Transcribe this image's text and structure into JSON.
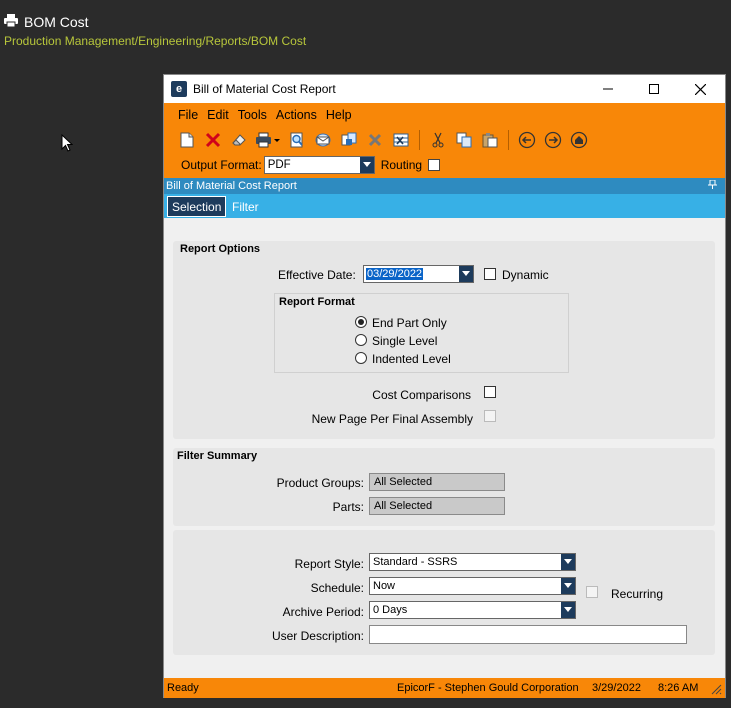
{
  "app": {
    "title": "BOM Cost",
    "breadcrumb": "Production Management/Engineering/Reports/BOM Cost"
  },
  "window": {
    "title": "Bill of Material Cost Report",
    "menu": [
      "File",
      "Edit",
      "Tools",
      "Actions",
      "Help"
    ],
    "toolbar_icons": [
      "new-icon",
      "delete-icon",
      "clear-icon",
      "print-icon",
      "print-preview-icon",
      "email-icon",
      "generate-icon",
      "cancel-icon",
      "excel-icon",
      "cut-icon",
      "copy-icon",
      "paste-icon",
      "back-icon",
      "forward-icon",
      "home-icon"
    ],
    "output_format_label": "Output Format:",
    "output_format_value": "PDF",
    "routing_label": "Routing",
    "panel_title": "Bill of Material Cost Report",
    "tabs": [
      "Selection",
      "Filter"
    ]
  },
  "report_options": {
    "title": "Report Options",
    "effective_date_label": "Effective Date:",
    "effective_date_value": "03/29/2022",
    "dynamic_label": "Dynamic",
    "report_format_title": "Report Format",
    "formats": [
      {
        "label": "End Part Only",
        "selected": true
      },
      {
        "label": "Single Level",
        "selected": false
      },
      {
        "label": "Indented Level",
        "selected": false
      }
    ],
    "cost_comparisons_label": "Cost Comparisons",
    "new_page_label": "New Page Per Final Assembly"
  },
  "filter_summary": {
    "title": "Filter Summary",
    "product_groups_label": "Product Groups:",
    "product_groups_value": "All Selected",
    "parts_label": "Parts:",
    "parts_value": "All Selected"
  },
  "schedule": {
    "report_style_label": "Report Style:",
    "report_style_value": "Standard - SSRS",
    "schedule_label": "Schedule:",
    "schedule_value": "Now",
    "recurring_label": "Recurring",
    "archive_label": "Archive Period:",
    "archive_value": "0 Days",
    "user_desc_label": "User Description:"
  },
  "status": {
    "state": "Ready",
    "company": "EpicorF - Stephen Gould Corporation",
    "date": "3/29/2022",
    "time": "8:26 AM"
  },
  "colors": {
    "accent": "#f88708",
    "header_blue": "#2e8bc0",
    "tab_blue": "#37b0e6",
    "navy": "#1d3b5c",
    "breadcrumb": "#b7c63b"
  }
}
